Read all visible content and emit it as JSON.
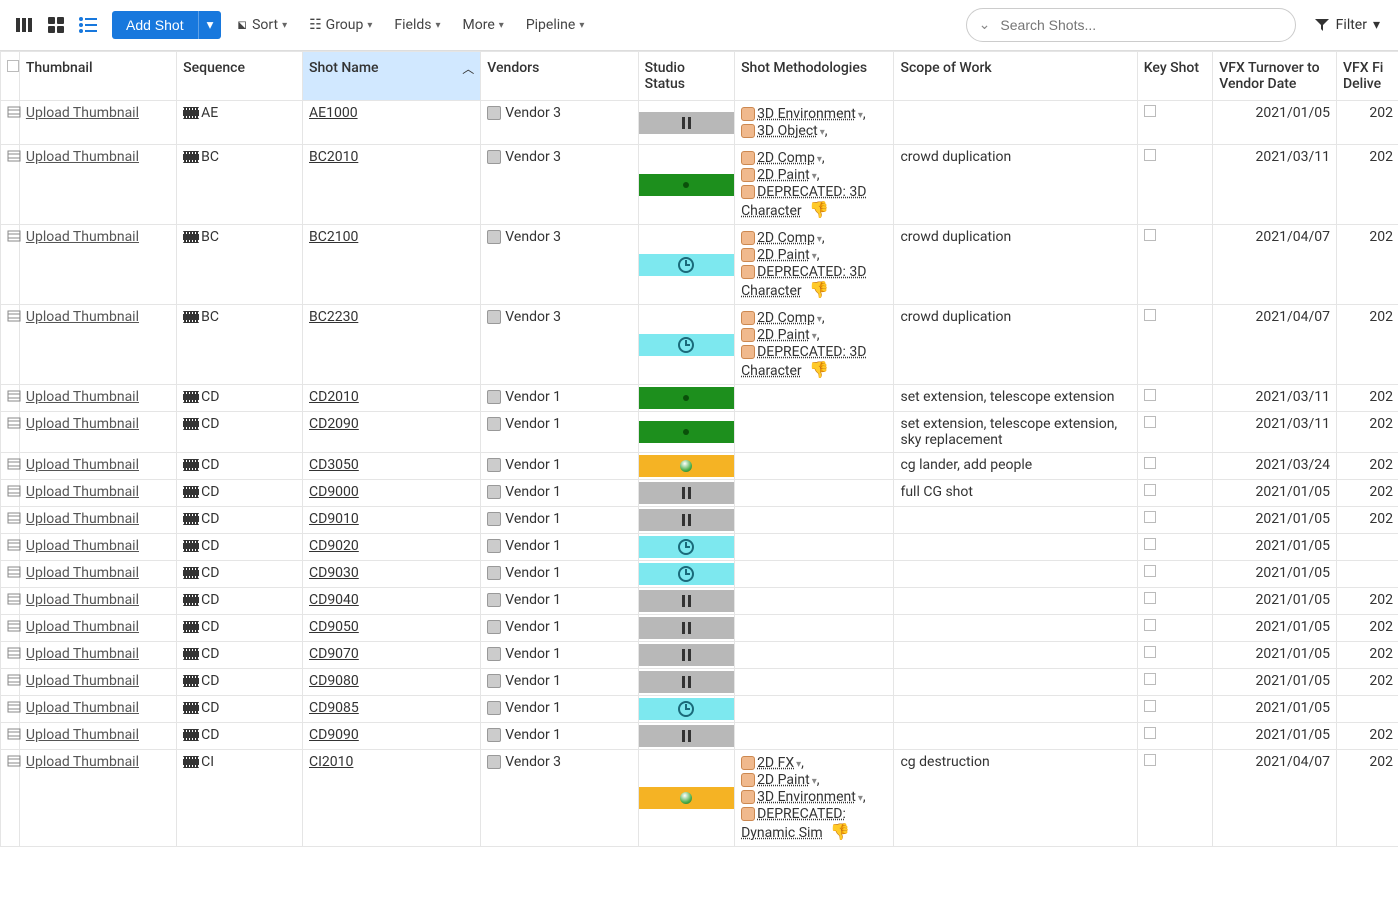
{
  "toolbar": {
    "add_shot": "Add Shot",
    "sort": "Sort",
    "group": "Group",
    "fields": "Fields",
    "more": "More",
    "pipeline": "Pipeline",
    "search_placeholder": "Search Shots...",
    "filter": "Filter"
  },
  "columns": {
    "thumbnail": "Thumbnail",
    "sequence": "Sequence",
    "shot_name": "Shot Name",
    "vendors": "Vendors",
    "studio_status": "Studio Status",
    "methodologies": "Shot Methodologies",
    "scope": "Scope of Work",
    "key_shot": "Key Shot",
    "vfx_turnover": "VFX Turnover to Vendor Date",
    "vfx_final": "VFX Fi Delive"
  },
  "rows": [
    {
      "seq": "AE",
      "name": "AE1000",
      "vendor": "Vendor 3",
      "status": "grey-pause",
      "meth": [
        {
          "t": "3D Environment",
          "c": true
        },
        {
          "t": "3D Object",
          "c": true
        }
      ],
      "scope": "",
      "turn": "2021/01/05",
      "vfx": "202"
    },
    {
      "seq": "BC",
      "name": "BC2010",
      "vendor": "Vendor 3",
      "status": "green-dot",
      "meth": [
        {
          "t": "2D Comp",
          "c": true
        },
        {
          "t": "2D Paint",
          "c": true
        },
        {
          "t": "DEPRECATED: 3D Character",
          "dep": true
        }
      ],
      "scope": "crowd duplication",
      "turn": "2021/03/11",
      "vfx": "202"
    },
    {
      "seq": "BC",
      "name": "BC2100",
      "vendor": "Vendor 3",
      "status": "cyan-clock",
      "meth": [
        {
          "t": "2D Comp",
          "c": true
        },
        {
          "t": "2D Paint",
          "c": true
        },
        {
          "t": "DEPRECATED: 3D Character",
          "dep": true
        }
      ],
      "scope": "crowd duplication",
      "turn": "2021/04/07",
      "vfx": "202"
    },
    {
      "seq": "BC",
      "name": "BC2230",
      "vendor": "Vendor 3",
      "status": "cyan-clock",
      "meth": [
        {
          "t": "2D Comp",
          "c": true
        },
        {
          "t": "2D Paint",
          "c": true
        },
        {
          "t": "DEPRECATED: 3D Character",
          "dep": true
        }
      ],
      "scope": "crowd duplication",
      "turn": "2021/04/07",
      "vfx": "202"
    },
    {
      "seq": "CD",
      "name": "CD2010",
      "vendor": "Vendor 1",
      "status": "green-dot",
      "meth": [],
      "scope": "set extension, telescope extension",
      "turn": "2021/03/11",
      "vfx": "202"
    },
    {
      "seq": "CD",
      "name": "CD2090",
      "vendor": "Vendor 1",
      "status": "green-dot",
      "meth": [],
      "scope": "set extension, telescope extension, sky replacement",
      "turn": "2021/03/11",
      "vfx": "202"
    },
    {
      "seq": "CD",
      "name": "CD3050",
      "vendor": "Vendor 1",
      "status": "amber-ball",
      "meth": [],
      "scope": "cg lander, add people",
      "turn": "2021/03/24",
      "vfx": "202"
    },
    {
      "seq": "CD",
      "name": "CD9000",
      "vendor": "Vendor 1",
      "status": "grey-pause",
      "meth": [],
      "scope": "full CG shot",
      "turn": "2021/01/05",
      "vfx": "202"
    },
    {
      "seq": "CD",
      "name": "CD9010",
      "vendor": "Vendor 1",
      "status": "grey-pause",
      "meth": [],
      "scope": "",
      "turn": "2021/01/05",
      "vfx": "202"
    },
    {
      "seq": "CD",
      "name": "CD9020",
      "vendor": "Vendor 1",
      "status": "cyan-clock",
      "meth": [],
      "scope": "",
      "turn": "2021/01/05",
      "vfx": ""
    },
    {
      "seq": "CD",
      "name": "CD9030",
      "vendor": "Vendor 1",
      "status": "cyan-clock",
      "meth": [],
      "scope": "",
      "turn": "2021/01/05",
      "vfx": ""
    },
    {
      "seq": "CD",
      "name": "CD9040",
      "vendor": "Vendor 1",
      "status": "grey-pause",
      "meth": [],
      "scope": "",
      "turn": "2021/01/05",
      "vfx": "202"
    },
    {
      "seq": "CD",
      "name": "CD9050",
      "vendor": "Vendor 1",
      "status": "grey-pause",
      "meth": [],
      "scope": "",
      "turn": "2021/01/05",
      "vfx": "202"
    },
    {
      "seq": "CD",
      "name": "CD9070",
      "vendor": "Vendor 1",
      "status": "grey-pause",
      "meth": [],
      "scope": "",
      "turn": "2021/01/05",
      "vfx": "202"
    },
    {
      "seq": "CD",
      "name": "CD9080",
      "vendor": "Vendor 1",
      "status": "grey-pause",
      "meth": [],
      "scope": "",
      "turn": "2021/01/05",
      "vfx": "202"
    },
    {
      "seq": "CD",
      "name": "CD9085",
      "vendor": "Vendor 1",
      "status": "cyan-clock",
      "meth": [],
      "scope": "",
      "turn": "2021/01/05",
      "vfx": ""
    },
    {
      "seq": "CD",
      "name": "CD9090",
      "vendor": "Vendor 1",
      "status": "grey-pause",
      "meth": [],
      "scope": "",
      "turn": "2021/01/05",
      "vfx": "202"
    },
    {
      "seq": "CI",
      "name": "CI2010",
      "vendor": "Vendor 3",
      "status": "amber-ball",
      "meth": [
        {
          "t": "2D FX",
          "c": true
        },
        {
          "t": "2D Paint",
          "c": true
        },
        {
          "t": "3D Environment",
          "c": true
        },
        {
          "t": "DEPRECATED: Dynamic Sim",
          "dep": true
        }
      ],
      "scope": "cg destruction",
      "turn": "2021/04/07",
      "vfx": "202"
    }
  ],
  "upload_label": "Upload Thumbnail"
}
